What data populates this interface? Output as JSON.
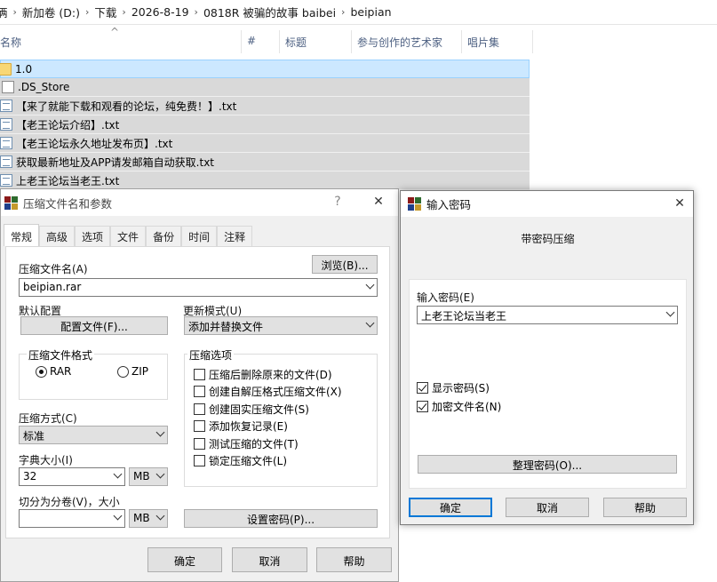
{
  "breadcrumb": [
    "⟨",
    "新加卷 (D:)",
    "下载",
    "2026-8-19",
    "0818R 被骗的故事 baibei",
    "beipian"
  ],
  "breadcrumb_first": "俩",
  "columns": [
    "名称",
    "#",
    "标题",
    "参与创作的艺术家",
    "唱片集"
  ],
  "files": [
    {
      "name": "1.0",
      "icon": "folder-icon"
    },
    {
      "name": ".DS_Store",
      "icon": "file-icon"
    },
    {
      "name": "【来了就能下载和观看的论坛，纯免费！】.txt",
      "icon": "text-file-icon"
    },
    {
      "name": "【老王论坛介绍】.txt",
      "icon": "text-file-icon"
    },
    {
      "name": "【老王论坛永久地址发布页】.txt",
      "icon": "text-file-icon"
    },
    {
      "name": "获取最新地址及APP请发邮箱自动获取.txt",
      "icon": "text-file-icon"
    },
    {
      "name": "上老王论坛当老王.txt",
      "icon": "text-file-icon"
    }
  ],
  "archive_dialog": {
    "title": "压缩文件名和参数",
    "help_glyph": "?",
    "close_glyph": "✕",
    "tabs": [
      "常规",
      "高级",
      "选项",
      "文件",
      "备份",
      "时间",
      "注释"
    ],
    "archive_name_label": "压缩文件名(A)",
    "browse_button": "浏览(B)...",
    "archive_name_value": "beipian.rar",
    "profile_label": "默认配置",
    "profile_button": "配置文件(F)...",
    "update_mode_label": "更新模式(U)",
    "update_mode_value": "添加并替换文件",
    "format_label": "压缩文件格式",
    "format_rar": "RAR",
    "format_zip": "ZIP",
    "options_label": "压缩选项",
    "options": [
      {
        "label": "压缩后删除原来的文件(D)",
        "checked": false
      },
      {
        "label": "创建自解压格式压缩文件(X)",
        "checked": false
      },
      {
        "label": "创建固实压缩文件(S)",
        "checked": false
      },
      {
        "label": "添加恢复记录(E)",
        "checked": false
      },
      {
        "label": "测试压缩的文件(T)",
        "checked": false
      },
      {
        "label": "锁定压缩文件(L)",
        "checked": false
      }
    ],
    "method_label": "压缩方式(C)",
    "method_value": "标准",
    "dict_label": "字典大小(I)",
    "dict_value": "32",
    "dict_unit": "MB",
    "split_label": "切分为分卷(V)，大小",
    "split_value": "",
    "split_unit": "MB",
    "set_password_button": "设置密码(P)...",
    "ok_button": "确定",
    "cancel_button": "取消",
    "help_button": "帮助"
  },
  "password_dialog": {
    "title": "输入密码",
    "close_glyph": "✕",
    "heading": "带密码压缩",
    "password_label": "输入密码(E)",
    "password_value": "上老王论坛当老王",
    "show_password_label": "显示密码(S)",
    "show_password_checked": true,
    "encrypt_names_label": "加密文件名(N)",
    "encrypt_names_checked": true,
    "organize_button": "整理密码(O)...",
    "ok_button": "确定",
    "cancel_button": "取消",
    "help_button": "帮助"
  }
}
